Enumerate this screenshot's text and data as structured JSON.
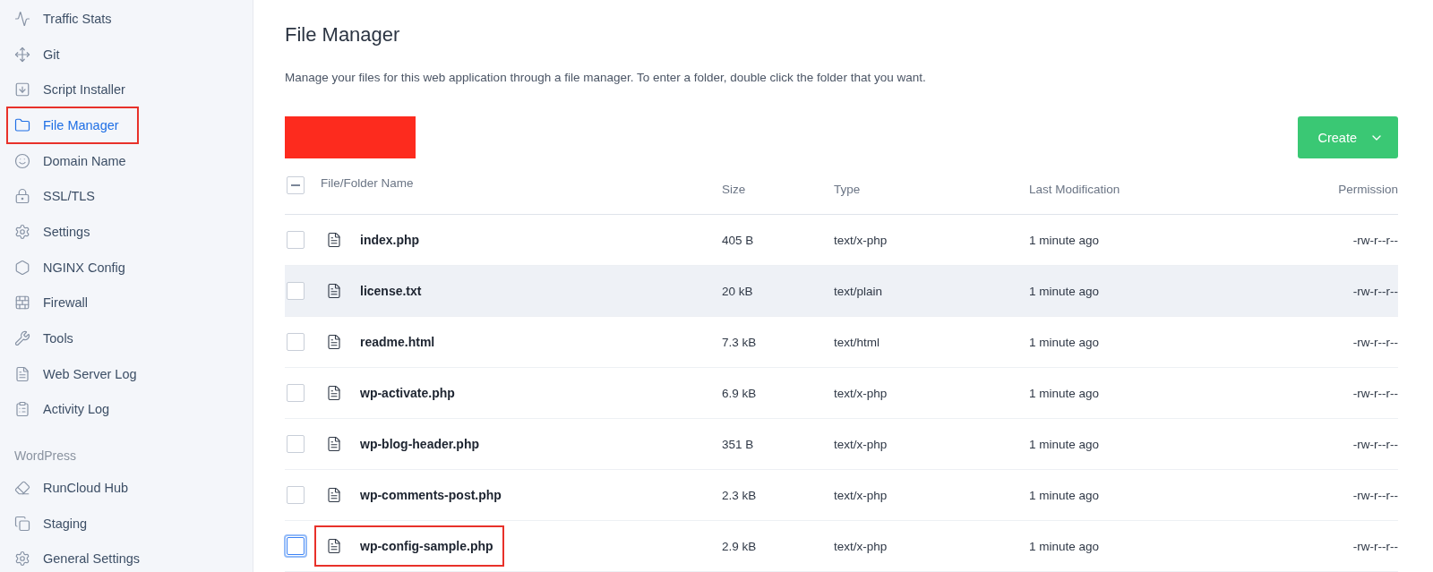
{
  "sidebar": {
    "groups": [
      {
        "items": [
          {
            "label": "Traffic Stats",
            "selected": false,
            "highlighted": false
          },
          {
            "label": "Git",
            "selected": false,
            "highlighted": false
          },
          {
            "label": "Script Installer",
            "selected": false,
            "highlighted": false
          },
          {
            "label": "File Manager",
            "selected": true,
            "highlighted": true
          },
          {
            "label": "Domain Name",
            "selected": false,
            "highlighted": false
          },
          {
            "label": "SSL/TLS",
            "selected": false,
            "highlighted": false
          },
          {
            "label": "Settings",
            "selected": false,
            "highlighted": false
          },
          {
            "label": "NGINX Config",
            "selected": false,
            "highlighted": false
          },
          {
            "label": "Firewall",
            "selected": false,
            "highlighted": false
          },
          {
            "label": "Tools",
            "selected": false,
            "highlighted": false
          },
          {
            "label": "Web Server Log",
            "selected": false,
            "highlighted": false
          },
          {
            "label": "Activity Log",
            "selected": false,
            "highlighted": false
          }
        ]
      },
      {
        "heading": "WordPress",
        "items": [
          {
            "label": "RunCloud Hub",
            "selected": false,
            "highlighted": false
          },
          {
            "label": "Staging",
            "selected": false,
            "highlighted": false
          },
          {
            "label": "General Settings",
            "selected": false,
            "highlighted": false
          }
        ]
      }
    ]
  },
  "page": {
    "title": "File Manager",
    "description": "Manage your files for this web application through a file manager. To enter a folder, double click the folder that you want.",
    "redacted": true,
    "create_button": "Create"
  },
  "table": {
    "select_all": {
      "indeterminate": true
    },
    "columns": [
      "File/Folder Name",
      "Size",
      "Type",
      "Last Modification",
      "Permission"
    ],
    "rows": [
      {
        "name": "index.php",
        "size": "405 B",
        "type": "text/x-php",
        "modified": "1 minute ago",
        "permission": "-rw-r--r--",
        "checked": false,
        "shaded": false,
        "focused": false,
        "highlighted": false
      },
      {
        "name": "license.txt",
        "size": "20 kB",
        "type": "text/plain",
        "modified": "1 minute ago",
        "permission": "-rw-r--r--",
        "checked": false,
        "shaded": true,
        "focused": false,
        "highlighted": false
      },
      {
        "name": "readme.html",
        "size": "7.3 kB",
        "type": "text/html",
        "modified": "1 minute ago",
        "permission": "-rw-r--r--",
        "checked": false,
        "shaded": false,
        "focused": false,
        "highlighted": false
      },
      {
        "name": "wp-activate.php",
        "size": "6.9 kB",
        "type": "text/x-php",
        "modified": "1 minute ago",
        "permission": "-rw-r--r--",
        "checked": false,
        "shaded": false,
        "focused": false,
        "highlighted": false
      },
      {
        "name": "wp-blog-header.php",
        "size": "351 B",
        "type": "text/x-php",
        "modified": "1 minute ago",
        "permission": "-rw-r--r--",
        "checked": false,
        "shaded": false,
        "focused": false,
        "highlighted": false
      },
      {
        "name": "wp-comments-post.php",
        "size": "2.3 kB",
        "type": "text/x-php",
        "modified": "1 minute ago",
        "permission": "-rw-r--r--",
        "checked": false,
        "shaded": false,
        "focused": false,
        "highlighted": false
      },
      {
        "name": "wp-config-sample.php",
        "size": "2.9 kB",
        "type": "text/x-php",
        "modified": "1 minute ago",
        "permission": "-rw-r--r--",
        "checked": false,
        "shaded": false,
        "focused": true,
        "highlighted": true
      }
    ]
  }
}
